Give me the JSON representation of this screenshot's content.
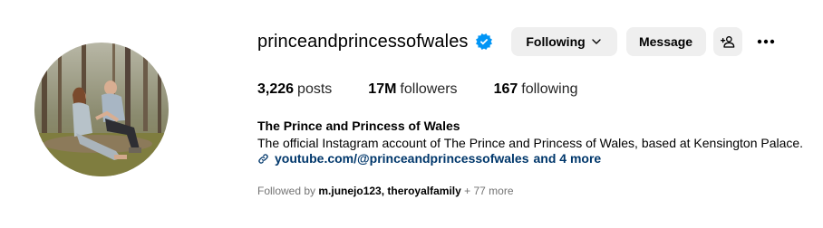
{
  "profile": {
    "username": "princeandprincessofwales",
    "full_name": "The Prince and Princess of Wales",
    "bio": "The official Instagram account of The Prince and Princess of Wales, based at Kensington Palace.",
    "link": "youtube.com/@princeandprincessofwales",
    "link_more": "and 4 more"
  },
  "buttons": {
    "following": "Following",
    "message": "Message"
  },
  "stats": {
    "posts_count": "3,226",
    "posts_label": "posts",
    "followers_count": "17M",
    "followers_label": "followers",
    "following_count": "167",
    "following_label": "following"
  },
  "followed_by": {
    "prefix": "Followed by",
    "user1": "m.junejo123",
    "sep": ",",
    "user2": "theroyalfamily",
    "more": "+ 77 more"
  },
  "icons": {
    "verified": "verified-badge-icon",
    "chevron": "chevron-down-icon",
    "add_user": "add-user-icon",
    "more": "more-options-icon",
    "link": "link-icon"
  },
  "colors": {
    "verified_blue": "#0095f6",
    "link_blue": "#00376b",
    "button_bg": "#efefef",
    "muted_text": "#737373"
  }
}
